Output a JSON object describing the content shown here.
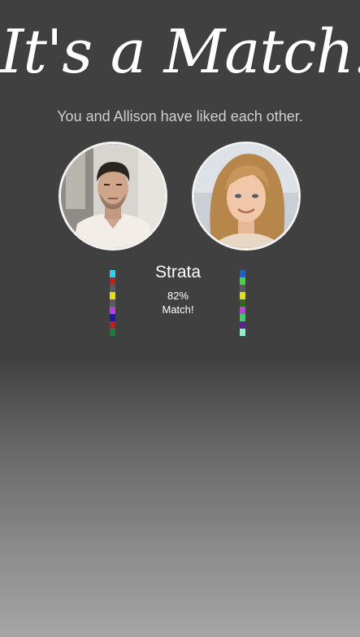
{
  "header": {
    "title": "It's a Match!",
    "subtitle": "You and Allison have liked each other."
  },
  "profiles": {
    "left": {
      "photo": "male-profile-photo"
    },
    "right": {
      "photo": "female-profile-photo",
      "name": "Allison"
    }
  },
  "match": {
    "category": "Strata",
    "percent": "82%",
    "label": "Match!"
  },
  "color_strips": {
    "left": [
      "#2fd0ee",
      "#c21d1d",
      "#5a5a5a",
      "#e8e000",
      "#5a5a5a",
      "#b640e0",
      "#1a1aa0",
      "#c21d1d",
      "#1d7a3c"
    ],
    "right": [
      "#1a60d0",
      "#38e038",
      "#5a5a5a",
      "#e8e000",
      "#2a6a1a",
      "#c040e0",
      "#38d060",
      "#6a1aa0",
      "#8ef0c8"
    ]
  },
  "colors": {
    "background_top": "#404040",
    "background_bottom": "#a6a6a6",
    "avatar_border": "#f3f3f3"
  }
}
